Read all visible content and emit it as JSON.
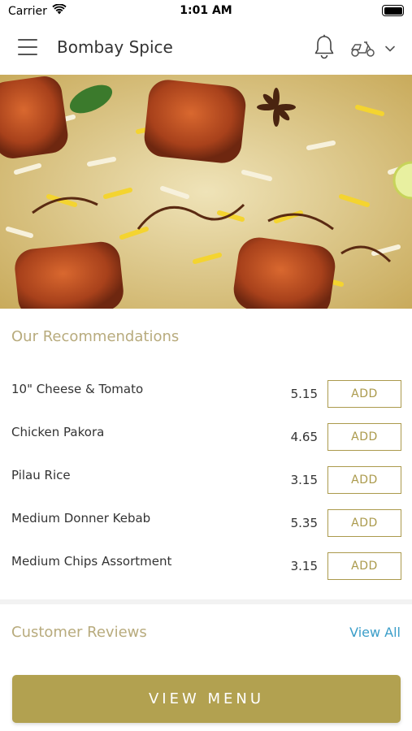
{
  "status_bar": {
    "carrier": "Carrier",
    "time": "1:01 AM"
  },
  "header": {
    "title": "Bombay Spice",
    "icons": [
      "menu-icon",
      "bell-icon",
      "scooter-icon",
      "chevron-down-icon"
    ]
  },
  "hero": {
    "image": "biryani-rice-dish-photo"
  },
  "recommendations": {
    "title": "Our Recommendations",
    "button_label": "ADD",
    "items": [
      {
        "name": "10\" Cheese & Tomato",
        "price": "5.15"
      },
      {
        "name": "Chicken Pakora",
        "price": "4.65"
      },
      {
        "name": "Pilau Rice",
        "price": "3.15"
      },
      {
        "name": "Medium Donner Kebab",
        "price": "5.35"
      },
      {
        "name": "Medium Chips Assortment",
        "price": "3.15"
      }
    ]
  },
  "reviews": {
    "title": "Customer Reviews",
    "view_all": "View All"
  },
  "footer": {
    "view_menu": "VIEW MENU"
  },
  "colors": {
    "accent_gold": "#b2a150",
    "section_title": "#b8ab7d",
    "link_blue": "#3b9ec9"
  }
}
